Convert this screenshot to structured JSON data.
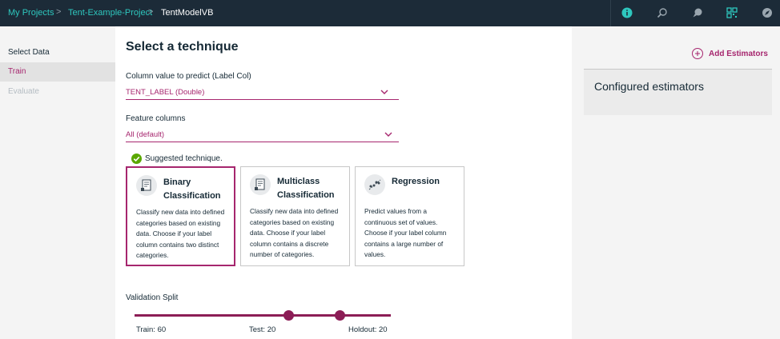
{
  "breadcrumb": {
    "items": [
      "My Projects",
      "Tent-Example-Project",
      "TentModelVB"
    ],
    "separator": ">"
  },
  "toolbar_icons": [
    "info-icon",
    "find-icon",
    "chat-icon",
    "qr-code-icon",
    "compass-icon"
  ],
  "colors": {
    "accent": "#a6266e",
    "link": "#2ec7be",
    "topbar": "#1c2b38",
    "success": "#5aa700"
  },
  "sidebar": {
    "items": [
      {
        "label": "Select Data",
        "state": "default"
      },
      {
        "label": "Train",
        "state": "active"
      },
      {
        "label": "Evaluate",
        "state": "disabled"
      }
    ]
  },
  "main": {
    "title": "Select a technique",
    "label_col": {
      "label": "Column value to predict (Label Col)",
      "value": "TENT_LABEL (Double)"
    },
    "feature_cols": {
      "label": "Feature columns",
      "value": "All (default)"
    },
    "suggested": "Suggested technique.",
    "cards": [
      {
        "title_line1": "Binary",
        "title_line2": "Classification",
        "desc": "Classify new data into defined categories based on existing data. Choose if your label column contains two distinct categories.",
        "selected": true,
        "icon": "document-icon"
      },
      {
        "title_line1": "Multiclass",
        "title_line2": "Classification",
        "desc": "Classify new data into defined categories based on existing data. Choose if your label column contains a discrete number of categories.",
        "selected": false,
        "icon": "document-icon"
      },
      {
        "title_line1": "Regression",
        "title_line2": "",
        "desc": "Predict values from a continuous set of values. Choose if your label column contains a large number of values.",
        "selected": false,
        "icon": "scatter-icon"
      }
    ],
    "validation": {
      "label": "Validation Split",
      "train": "Train: 60",
      "test": "Test: 20",
      "holdout": "Holdout: 20",
      "train_pct": 60,
      "test_pct": 20,
      "holdout_pct": 20
    }
  },
  "right": {
    "add_estimators": "Add Estimators",
    "configured_title": "Configured estimators"
  }
}
